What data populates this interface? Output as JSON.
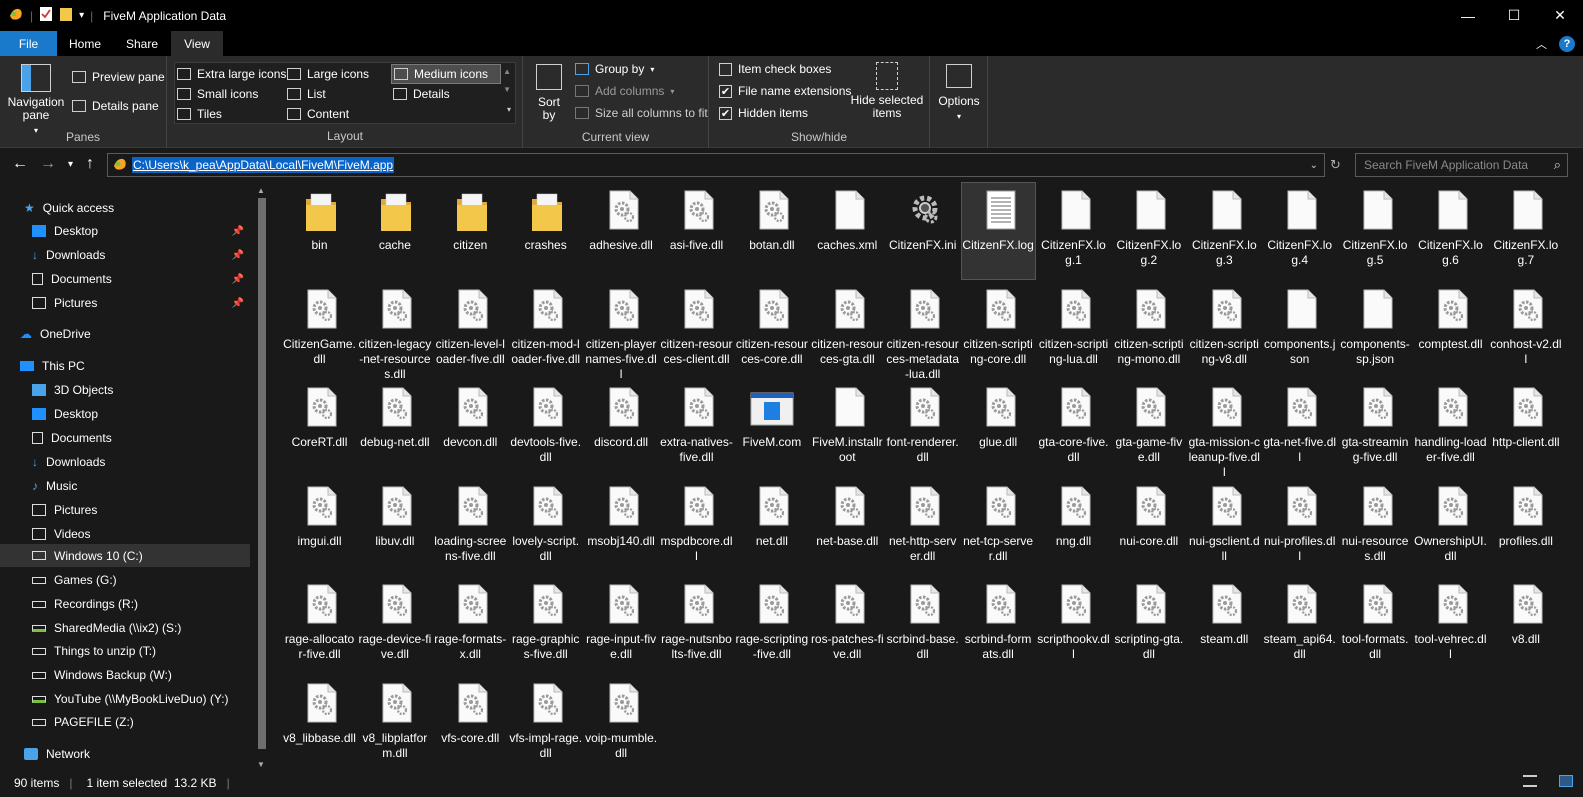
{
  "window": {
    "title": "FiveM Application Data",
    "minimize": "—",
    "maximize": "☐",
    "close": "✕"
  },
  "tabs": [
    "File",
    "Home",
    "Share",
    "View"
  ],
  "ribbon": {
    "panes": {
      "navigation_pane": "Navigation pane",
      "preview_pane": "Preview pane",
      "details_pane": "Details pane",
      "label": "Panes"
    },
    "layout": {
      "items": [
        "Extra large icons",
        "Large icons",
        "Medium icons",
        "Small icons",
        "List",
        "Details",
        "Tiles",
        "Content"
      ],
      "selected": "Medium icons",
      "label": "Layout"
    },
    "current_view": {
      "sort_by": "Sort by",
      "group_by": "Group by",
      "add_columns": "Add columns",
      "size_columns": "Size all columns to fit",
      "label": "Current view"
    },
    "show_hide": {
      "item_check_boxes": "Item check boxes",
      "item_check_boxes_checked": false,
      "file_name_extensions": "File name extensions",
      "file_name_extensions_checked": true,
      "hidden_items": "Hidden items",
      "hidden_items_checked": true,
      "hide_selected": "Hide selected items",
      "label": "Show/hide"
    },
    "options": "Options"
  },
  "address": {
    "path": "C:\\Users\\k_pea\\AppData\\Local\\FiveM\\FiveM.app",
    "search_placeholder": "Search FiveM Application Data"
  },
  "sidebar": {
    "quick_access": "Quick access",
    "quick_items": [
      "Desktop",
      "Downloads",
      "Documents",
      "Pictures"
    ],
    "onedrive": "OneDrive",
    "this_pc": "This PC",
    "pc_items": [
      "3D Objects",
      "Desktop",
      "Documents",
      "Downloads",
      "Music",
      "Pictures",
      "Videos",
      "Windows 10 (C:)",
      "Games (G:)",
      "Recordings (R:)",
      "SharedMedia (\\\\ix2) (S:)",
      "Things to unzip (T:)",
      "Windows Backup (W:)",
      "YouTube (\\\\MyBookLiveDuo) (Y:)",
      "PAGEFILE (Z:)"
    ],
    "selected": "Windows 10 (C:)",
    "network": "Network"
  },
  "files": [
    {
      "name": "bin",
      "type": "folder"
    },
    {
      "name": "cache",
      "type": "folder"
    },
    {
      "name": "citizen",
      "type": "folder"
    },
    {
      "name": "crashes",
      "type": "folder"
    },
    {
      "name": "adhesive.dll",
      "type": "dll"
    },
    {
      "name": "asi-five.dll",
      "type": "dll"
    },
    {
      "name": "botan.dll",
      "type": "dll"
    },
    {
      "name": "caches.xml",
      "type": "blank"
    },
    {
      "name": "CitizenFX.ini",
      "type": "ini"
    },
    {
      "name": "CitizenFX.log",
      "type": "log",
      "selected": true
    },
    {
      "name": "CitizenFX.log.1",
      "type": "blank"
    },
    {
      "name": "CitizenFX.log.2",
      "type": "blank"
    },
    {
      "name": "CitizenFX.log.3",
      "type": "blank"
    },
    {
      "name": "CitizenFX.log.4",
      "type": "blank"
    },
    {
      "name": "CitizenFX.log.5",
      "type": "blank"
    },
    {
      "name": "CitizenFX.log.6",
      "type": "blank"
    },
    {
      "name": "CitizenFX.log.7",
      "type": "blank"
    },
    {
      "name": "CitizenGame.dll",
      "type": "dll"
    },
    {
      "name": "citizen-legacy-net-resources.dll",
      "type": "dll"
    },
    {
      "name": "citizen-level-loader-five.dll",
      "type": "dll"
    },
    {
      "name": "citizen-mod-loader-five.dll",
      "type": "dll"
    },
    {
      "name": "citizen-playernames-five.dll",
      "type": "dll"
    },
    {
      "name": "citizen-resources-client.dll",
      "type": "dll"
    },
    {
      "name": "citizen-resources-core.dll",
      "type": "dll"
    },
    {
      "name": "citizen-resources-gta.dll",
      "type": "dll"
    },
    {
      "name": "citizen-resources-metadata-lua.dll",
      "type": "dll"
    },
    {
      "name": "citizen-scripting-core.dll",
      "type": "dll"
    },
    {
      "name": "citizen-scripting-lua.dll",
      "type": "dll"
    },
    {
      "name": "citizen-scripting-mono.dll",
      "type": "dll"
    },
    {
      "name": "citizen-scripting-v8.dll",
      "type": "dll"
    },
    {
      "name": "components.json",
      "type": "blank"
    },
    {
      "name": "components-sp.json",
      "type": "blank"
    },
    {
      "name": "comptest.dll",
      "type": "dll"
    },
    {
      "name": "conhost-v2.dll",
      "type": "dll"
    },
    {
      "name": "CoreRT.dll",
      "type": "dll"
    },
    {
      "name": "debug-net.dll",
      "type": "dll"
    },
    {
      "name": "devcon.dll",
      "type": "dll"
    },
    {
      "name": "devtools-five.dll",
      "type": "dll"
    },
    {
      "name": "discord.dll",
      "type": "dll"
    },
    {
      "name": "extra-natives-five.dll",
      "type": "dll"
    },
    {
      "name": "FiveM.com",
      "type": "app"
    },
    {
      "name": "FiveM.installroot",
      "type": "blank"
    },
    {
      "name": "font-renderer.dll",
      "type": "dll"
    },
    {
      "name": "glue.dll",
      "type": "dll"
    },
    {
      "name": "gta-core-five.dll",
      "type": "dll"
    },
    {
      "name": "gta-game-five.dll",
      "type": "dll"
    },
    {
      "name": "gta-mission-cleanup-five.dll",
      "type": "dll"
    },
    {
      "name": "gta-net-five.dll",
      "type": "dll"
    },
    {
      "name": "gta-streaming-five.dll",
      "type": "dll"
    },
    {
      "name": "handling-loader-five.dll",
      "type": "dll"
    },
    {
      "name": "http-client.dll",
      "type": "dll"
    },
    {
      "name": "imgui.dll",
      "type": "dll"
    },
    {
      "name": "libuv.dll",
      "type": "dll"
    },
    {
      "name": "loading-screens-five.dll",
      "type": "dll"
    },
    {
      "name": "lovely-script.dll",
      "type": "dll"
    },
    {
      "name": "msobj140.dll",
      "type": "dll"
    },
    {
      "name": "mspdbcore.dll",
      "type": "dll"
    },
    {
      "name": "net.dll",
      "type": "dll"
    },
    {
      "name": "net-base.dll",
      "type": "dll"
    },
    {
      "name": "net-http-server.dll",
      "type": "dll"
    },
    {
      "name": "net-tcp-server.dll",
      "type": "dll"
    },
    {
      "name": "nng.dll",
      "type": "dll"
    },
    {
      "name": "nui-core.dll",
      "type": "dll"
    },
    {
      "name": "nui-gsclient.dll",
      "type": "dll"
    },
    {
      "name": "nui-profiles.dll",
      "type": "dll"
    },
    {
      "name": "nui-resources.dll",
      "type": "dll"
    },
    {
      "name": "OwnershipUI.dll",
      "type": "dll"
    },
    {
      "name": "profiles.dll",
      "type": "dll"
    },
    {
      "name": "rage-allocator-five.dll",
      "type": "dll"
    },
    {
      "name": "rage-device-five.dll",
      "type": "dll"
    },
    {
      "name": "rage-formats-x.dll",
      "type": "dll"
    },
    {
      "name": "rage-graphics-five.dll",
      "type": "dll"
    },
    {
      "name": "rage-input-five.dll",
      "type": "dll"
    },
    {
      "name": "rage-nutsnbolts-five.dll",
      "type": "dll"
    },
    {
      "name": "rage-scripting-five.dll",
      "type": "dll"
    },
    {
      "name": "ros-patches-five.dll",
      "type": "dll"
    },
    {
      "name": "scrbind-base.dll",
      "type": "dll"
    },
    {
      "name": "scrbind-formats.dll",
      "type": "dll"
    },
    {
      "name": "scripthookv.dll",
      "type": "dll"
    },
    {
      "name": "scripting-gta.dll",
      "type": "dll"
    },
    {
      "name": "steam.dll",
      "type": "dll"
    },
    {
      "name": "steam_api64.dll",
      "type": "dll"
    },
    {
      "name": "tool-formats.dll",
      "type": "dll"
    },
    {
      "name": "tool-vehrec.dll",
      "type": "dll"
    },
    {
      "name": "v8.dll",
      "type": "dll"
    },
    {
      "name": "v8_libbase.dll",
      "type": "dll"
    },
    {
      "name": "v8_libplatform.dll",
      "type": "dll"
    },
    {
      "name": "vfs-core.dll",
      "type": "dll"
    },
    {
      "name": "vfs-impl-rage.dll",
      "type": "dll"
    },
    {
      "name": "voip-mumble.dll",
      "type": "dll"
    }
  ],
  "status": {
    "count": "90 items",
    "selection": "1 item selected  13.2 KB"
  },
  "colors": {
    "accent": "#1979ca",
    "background": "#191919",
    "ribbon": "#2b2b2b",
    "folder": "#f3c84a"
  }
}
